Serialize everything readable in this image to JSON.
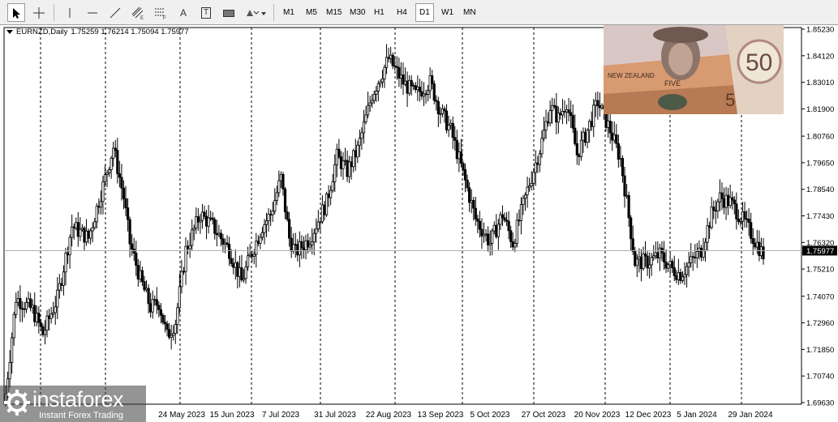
{
  "toolbar": {
    "tools": [
      {
        "name": "cursor-tool"
      },
      {
        "name": "crosshair-tool"
      },
      {
        "name": "vertical-line-tool"
      },
      {
        "name": "horizontal-line-tool"
      },
      {
        "name": "trendline-tool"
      },
      {
        "name": "equidistant-channel-tool"
      },
      {
        "name": "fibonacci-retracement-tool"
      },
      {
        "name": "text-tool",
        "label": "A"
      },
      {
        "name": "text-label-tool",
        "label": "T"
      },
      {
        "name": "rectangle-tool"
      },
      {
        "name": "shapes-dropdown-tool"
      }
    ],
    "timeframes": [
      "M1",
      "M5",
      "M15",
      "M30",
      "H1",
      "H4",
      "D1",
      "W1",
      "MN"
    ],
    "active_timeframe": "D1"
  },
  "chart_header": {
    "symbol": "EURNZD,Daily",
    "ohlc": "1.75259 1.76214 1.75094 1.75977"
  },
  "chart_data": {
    "type": "candlestick",
    "symbol": "EURNZD",
    "timeframe": "Daily",
    "y_ticks": [
      "1.85230",
      "1.84120",
      "1.83010",
      "1.81900",
      "1.80760",
      "1.79650",
      "1.78540",
      "1.77430",
      "1.76320",
      "1.75210",
      "1.74070",
      "1.72960",
      "1.71850",
      "1.70740",
      "1.69630"
    ],
    "ylim": [
      1.6963,
      1.8523
    ],
    "x_ticks": [
      "24 May 2023",
      "15 Jun 2023",
      "7 Jul 2023",
      "31 Jul 2023",
      "22 Aug 2023",
      "13 Sep 2023",
      "5 Oct 2023",
      "27 Oct 2023",
      "20 Nov 2023",
      "12 Dec 2023",
      "5 Jan 2024",
      "29 Jan 2024"
    ],
    "current_price": "1.75977",
    "grid": "vertical-dashed",
    "close_path": [
      [
        0,
        1.7
      ],
      [
        5,
        1.74
      ],
      [
        13,
        1.735
      ],
      [
        18,
        1.725
      ],
      [
        25,
        1.74
      ],
      [
        32,
        1.77
      ],
      [
        40,
        1.765
      ],
      [
        48,
        1.79
      ],
      [
        52,
        1.803
      ],
      [
        57,
        1.782
      ],
      [
        60,
        1.763
      ],
      [
        65,
        1.748
      ],
      [
        70,
        1.736
      ],
      [
        74,
        1.738
      ],
      [
        78,
        1.724
      ],
      [
        82,
        1.73
      ],
      [
        87,
        1.76
      ],
      [
        94,
        1.775
      ],
      [
        100,
        1.77
      ],
      [
        108,
        1.76
      ],
      [
        114,
        1.747
      ],
      [
        118,
        1.757
      ],
      [
        124,
        1.77
      ],
      [
        128,
        1.775
      ],
      [
        133,
        1.79
      ],
      [
        137,
        1.765
      ],
      [
        140,
        1.759
      ],
      [
        147,
        1.765
      ],
      [
        155,
        1.78
      ],
      [
        160,
        1.799
      ],
      [
        165,
        1.793
      ],
      [
        170,
        1.802
      ],
      [
        177,
        1.825
      ],
      [
        185,
        1.84
      ],
      [
        192,
        1.83
      ],
      [
        198,
        1.825
      ],
      [
        205,
        1.83
      ],
      [
        210,
        1.818
      ],
      [
        215,
        1.81
      ],
      [
        220,
        1.795
      ],
      [
        227,
        1.773
      ],
      [
        234,
        1.763
      ],
      [
        240,
        1.775
      ],
      [
        245,
        1.763
      ],
      [
        252,
        1.785
      ],
      [
        258,
        1.802
      ],
      [
        263,
        1.82
      ],
      [
        267,
        1.815
      ],
      [
        271,
        1.822
      ],
      [
        276,
        1.8
      ],
      [
        281,
        1.81
      ],
      [
        286,
        1.822
      ],
      [
        292,
        1.81
      ],
      [
        297,
        1.798
      ],
      [
        300,
        1.78
      ],
      [
        304,
        1.755
      ],
      [
        310,
        1.755
      ],
      [
        316,
        1.758
      ],
      [
        322,
        1.752
      ],
      [
        326,
        1.75
      ],
      [
        331,
        1.755
      ],
      [
        336,
        1.76
      ],
      [
        341,
        1.775
      ],
      [
        345,
        1.782
      ],
      [
        350,
        1.78
      ],
      [
        355,
        1.774
      ],
      [
        358,
        1.77
      ],
      [
        362,
        1.764
      ],
      [
        366,
        1.758
      ]
    ]
  },
  "photo": {
    "alt": "banknotes"
  },
  "watermark": {
    "brand": "instaforex",
    "tagline": "Instant Forex Trading"
  }
}
